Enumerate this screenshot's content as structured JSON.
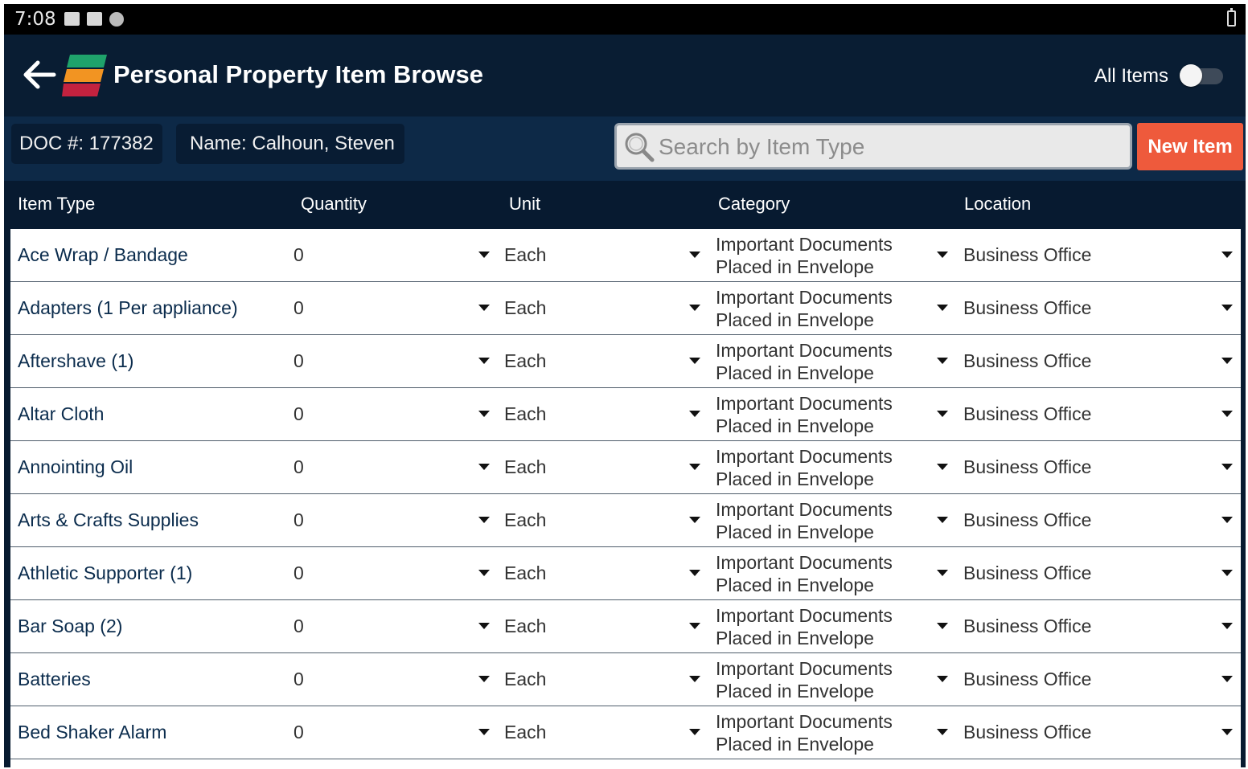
{
  "status_bar": {
    "time": "7:08"
  },
  "app_bar": {
    "title": "Personal Property Item Browse",
    "all_items_label": "All Items",
    "all_items_on": false
  },
  "info": {
    "doc": "DOC #: 177382",
    "name": "Name: Calhoun, Steven"
  },
  "search": {
    "placeholder": "Search by Item Type"
  },
  "new_item_label": "New Item",
  "columns": {
    "item_type": "Item Type",
    "quantity": "Quantity",
    "unit": "Unit",
    "category": "Category",
    "location": "Location"
  },
  "rows": [
    {
      "item_type": "Ace Wrap / Bandage",
      "quantity": "0",
      "unit": "Each",
      "category": "Important Documents Placed in Envelope",
      "location": "Business Office"
    },
    {
      "item_type": "Adapters (1 Per appliance)",
      "quantity": "0",
      "unit": "Each",
      "category": "Important Documents Placed in Envelope",
      "location": "Business Office"
    },
    {
      "item_type": "Aftershave (1)",
      "quantity": "0",
      "unit": "Each",
      "category": "Important Documents Placed in Envelope",
      "location": "Business Office"
    },
    {
      "item_type": "Altar Cloth",
      "quantity": "0",
      "unit": "Each",
      "category": "Important Documents Placed in Envelope",
      "location": "Business Office"
    },
    {
      "item_type": "Annointing Oil",
      "quantity": "0",
      "unit": "Each",
      "category": "Important Documents Placed in Envelope",
      "location": "Business Office"
    },
    {
      "item_type": "Arts & Crafts Supplies",
      "quantity": "0",
      "unit": "Each",
      "category": "Important Documents Placed in Envelope",
      "location": "Business Office"
    },
    {
      "item_type": "Athletic Supporter (1)",
      "quantity": "0",
      "unit": "Each",
      "category": "Important Documents Placed in Envelope",
      "location": "Business Office"
    },
    {
      "item_type": "Bar Soap (2)",
      "quantity": "0",
      "unit": "Each",
      "category": "Important Documents Placed in Envelope",
      "location": "Business Office"
    },
    {
      "item_type": "Batteries",
      "quantity": "0",
      "unit": "Each",
      "category": "Important Documents Placed in Envelope",
      "location": "Business Office"
    },
    {
      "item_type": "Bed Shaker Alarm",
      "quantity": "0",
      "unit": "Each",
      "category": "Important Documents Placed in Envelope",
      "location": "Business Office"
    }
  ],
  "colors": {
    "app_bar": "#091d33",
    "info_bar": "#0d2947",
    "accent": "#ee5a3c",
    "row_text": "#0b2c4d"
  }
}
